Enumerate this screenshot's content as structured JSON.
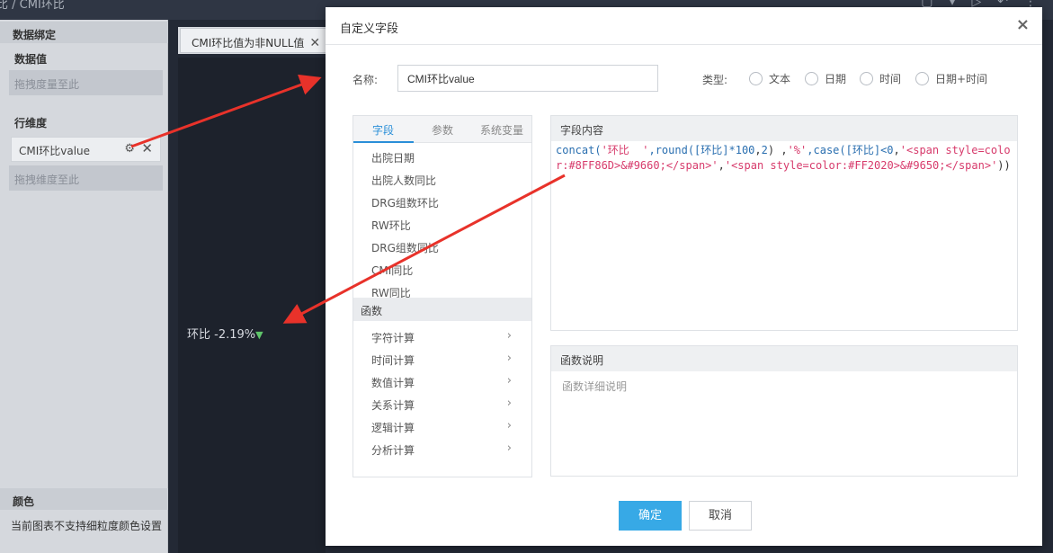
{
  "app": {
    "breadcrumb": "比 / CMI环比",
    "left_panel": {
      "data_binding_title": "数据绑定",
      "measure_label": "数据值",
      "measure_drop_hint": "拖拽度量至此",
      "row_dim_label": "行维度",
      "dim_chip": "CMI环比value",
      "dim_drop_hint": "拖拽维度至此",
      "color_title": "颜色",
      "color_note": "当前图表不支持细粒度颜色设置"
    },
    "tab": {
      "label": "CMI环比值为非NULL值"
    },
    "kpi": {
      "text": "环比 -2.19%",
      "arrow": "▼",
      "arrow_color": "#5fc56a"
    }
  },
  "dialog": {
    "title": "自定义字段",
    "close": "×",
    "name_label": "名称:",
    "name_value": "CMI环比value",
    "type_label": "类型:",
    "type_options": [
      "文本",
      "日期",
      "时间",
      "日期+时间"
    ],
    "lib_tabs": [
      "字段",
      "参数",
      "系统变量"
    ],
    "active_lib_tab": "字段",
    "fields": [
      "出院日期",
      "出院人数同比",
      "DRG组数环比",
      "RW环比",
      "DRG组数同比",
      "CMI同比",
      "RW同比"
    ],
    "func_head": "函数",
    "func_groups": [
      "字符计算",
      "时间计算",
      "数值计算",
      "关系计算",
      "逻辑计算",
      "分析计算"
    ],
    "content_head": "字段内容",
    "expression": {
      "p1": "concat(",
      "p2": "'环比  '",
      "p3": ",round([环比]*",
      "p4": "100",
      "p5": ",",
      "p6": "2",
      "p7": ") ,",
      "p8": "'%'",
      "p9": ",case([环比]<",
      "p10": "0",
      "p11": ",",
      "p12": "'<span style=color:#8FF86D>&#9660;</span>'",
      "p13": ",",
      "p14": "'<span style=color:#FF2020>&#9650;</span>'",
      "p15": "))"
    },
    "desc_head": "函数说明",
    "desc_body": "函数详细说明",
    "ok": "确定",
    "cancel": "取消"
  },
  "colors": {
    "primary": "#37a9e6",
    "annotation_arrow": "#e8322a"
  }
}
